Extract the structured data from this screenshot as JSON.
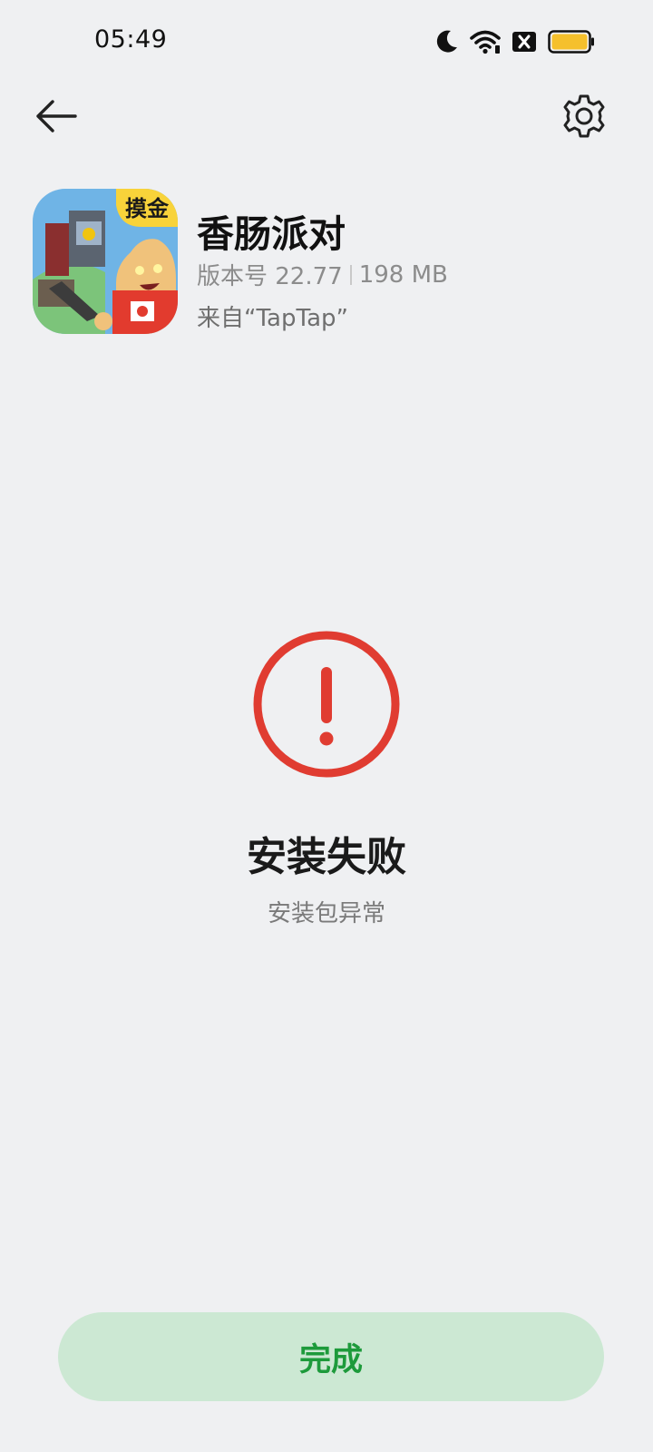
{
  "status_bar": {
    "time": "05:49",
    "icons": [
      "moon-icon",
      "wifi-icon",
      "sim-disabled-icon",
      "battery-icon"
    ],
    "battery_color": "#f5c02c"
  },
  "top_bar": {
    "back_icon": "arrow-left-icon",
    "settings_icon": "gear-icon"
  },
  "app": {
    "name": "香肠派对",
    "version": "版本号 22.77",
    "size": "198 MB",
    "source": "来自“TapTap”",
    "icon_badge": "摸金"
  },
  "result": {
    "icon": "error-exclamation-icon",
    "accent_color": "#e03c31",
    "title": "安装失败",
    "subtitle": "安装包异常"
  },
  "actions": {
    "done_label": "完成",
    "done_color": "#1d9a3b",
    "done_bg": "#cce8d3"
  }
}
